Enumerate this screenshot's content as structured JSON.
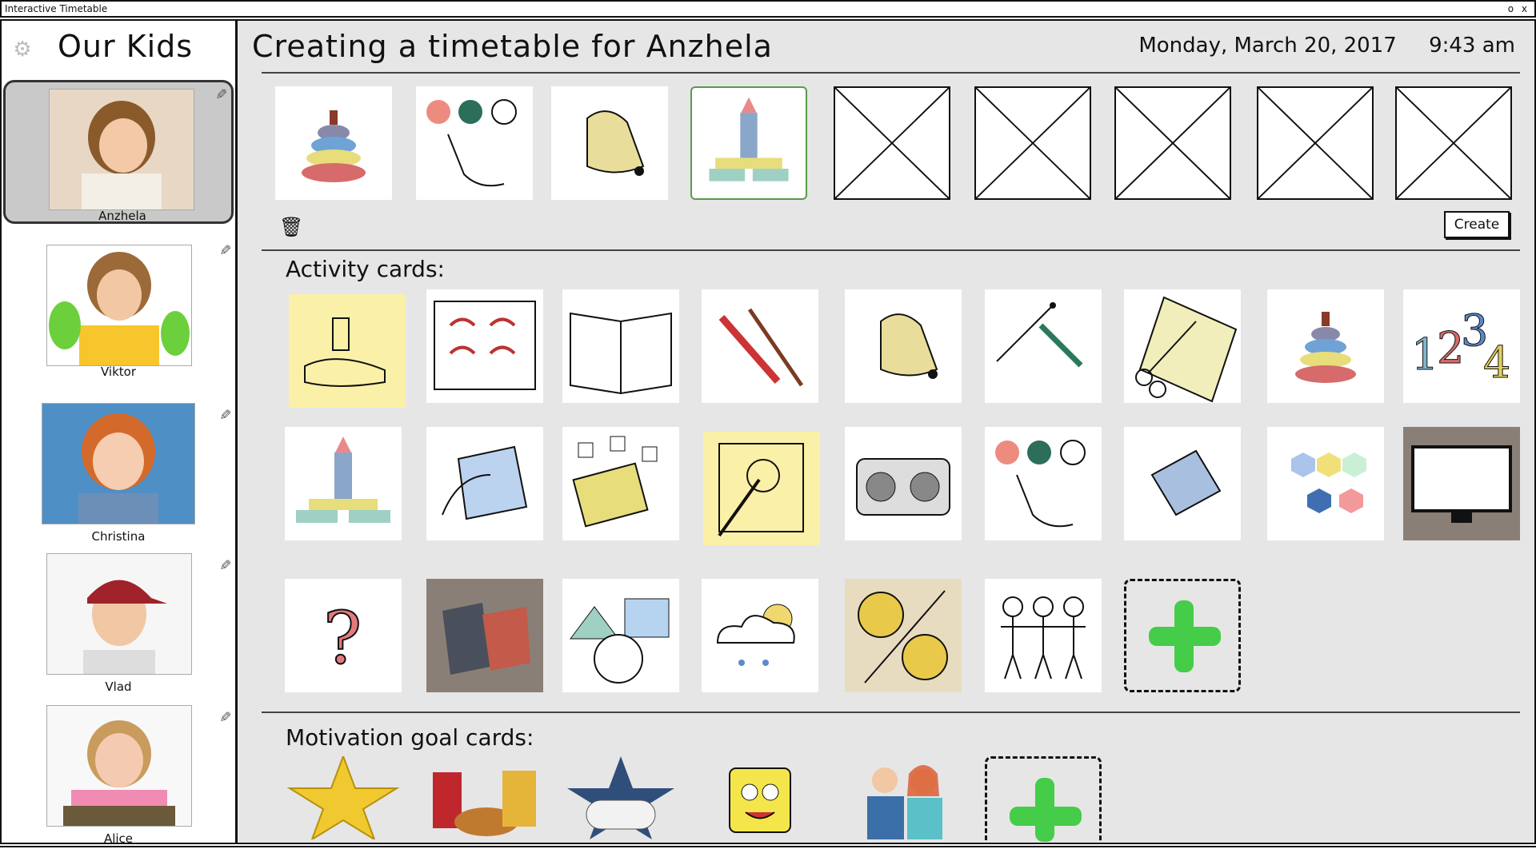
{
  "window": {
    "title": "Interactive Timetable",
    "controls": "o x"
  },
  "sidebar": {
    "title": "Our Kids",
    "kids": [
      {
        "name": "Anzhela",
        "selected": true
      },
      {
        "name": "Viktor"
      },
      {
        "name": "Christina"
      },
      {
        "name": "Vlad"
      },
      {
        "name": "Alice"
      }
    ]
  },
  "header": {
    "title": "Creating a timetable for Anzhela",
    "date": "Monday, March 20, 2017",
    "time": "9:43 am"
  },
  "timetable": {
    "slots": [
      "pyramid-icon",
      "color-dots-icon",
      "bell-icon",
      "tower-icon",
      "empty",
      "empty",
      "empty",
      "empty",
      "empty"
    ],
    "create_label": "Create"
  },
  "activity": {
    "label": "Activity cards:",
    "cards": [
      "hands-icon",
      "lacing-board-icon",
      "book-icon",
      "pencil-brush-icon",
      "bell-icon",
      "draw-line-icon",
      "scissors-icon",
      "pyramid-icon",
      "numbers-icon",
      "tower-icon",
      "wipe-icon",
      "letter-blocks-icon",
      "hatching-icon",
      "radio-icon",
      "color-dots-icon",
      "tablet-icon",
      "hexagons-icon",
      "monitor-icon",
      "question-icon",
      "puzzle-icon",
      "shapes-icon",
      "weather-icon",
      "smile-sad-icon",
      "people-icon"
    ]
  },
  "motivation": {
    "label": "Motivation goal cards:",
    "cards": [
      "star-icon",
      "fast-food-icon",
      "game-controller-icon",
      "sponge-cartoon-icon",
      "parents-icon"
    ]
  },
  "colors": {
    "add_green": "#45cc48",
    "selected_border": "#5a9a4a",
    "panel_bg": "#e6e6e6"
  }
}
